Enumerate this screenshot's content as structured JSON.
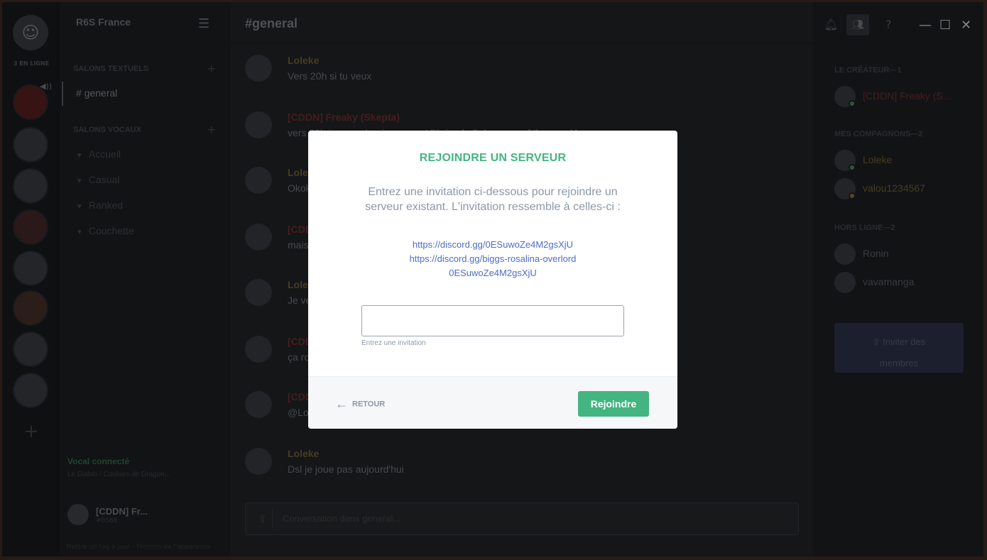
{
  "colors": {
    "accent_green": "#43b581",
    "link_blue": "#4f6cc7",
    "muted_text": "#8d98a7"
  },
  "guild_rail": {
    "online_count": "3 EN LIGNE"
  },
  "sidebar": {
    "server_name": "R6S France",
    "text_category": "SALONS TEXTUELS",
    "voice_category": "SALONS VOCAUX",
    "active_channel": "general",
    "voice_channels": [
      "Accueil",
      "Casual",
      "Ranked",
      "Couchette"
    ],
    "voice_status": "Vocal connecté",
    "voice_sub": "Le Diablo / Couloirs de Dragon...",
    "user_name": "[CDDN] Fr...",
    "user_tag": "#0568",
    "footer": "Mettre un tag à jour  ·  Thèmes de l'apparence"
  },
  "chat": {
    "channel_title": "#general",
    "composer_placeholder": "Conversation dans general...",
    "messages": [
      {
        "author": "Loleke",
        "text": "Vers 20h si tu veux",
        "red": false
      },
      {
        "author": "[CDDN] Freaky (Skepta)",
        "text": "vers 20h je regarderai comment l'épisode 2 de game of thrones ^^",
        "red": true
      },
      {
        "author": "Loleke",
        "text": "Okok",
        "red": false
      },
      {
        "author": "[CDDN]",
        "text": "mais",
        "red": true
      },
      {
        "author": "Loleke",
        "text": "Je ve",
        "red": false
      },
      {
        "author": "[CDDN]",
        "text": "ça ro",
        "red": true
      },
      {
        "author": "[CDDN]",
        "text": "@Lol",
        "red": true
      },
      {
        "author": "Loleke",
        "text": "Dsl je joue pas aujourd'hui",
        "red": false
      }
    ]
  },
  "members": {
    "creator_category": "LE CRÉATEUR—1",
    "creator": "[CDDN] Freaky (S...",
    "friends_category": "MES COMPAGNONS—2",
    "friends": [
      "Loleke",
      "valou1234567"
    ],
    "offline_category": "HORS LIGNE—2",
    "offline": [
      "Ronin",
      "vavamanga"
    ],
    "invite_label_1": "Inviter des",
    "invite_label_2": "membres"
  },
  "modal": {
    "title": "REJOINDRE UN SERVEUR",
    "description": "Entrez une invitation ci-dessous pour rejoindre un serveur existant. L'invitation ressemble à celles-ci :",
    "examples": [
      "https://discord.gg/0ESuwoZe4M2gsXjU",
      "https://discord.gg/biggs-rosalina-overlord",
      "0ESuwoZe4M2gsXjU"
    ],
    "input_value": "",
    "input_hint": "Entrez une invitation",
    "back_label": "RETOUR",
    "join_label": "Rejoindre"
  }
}
